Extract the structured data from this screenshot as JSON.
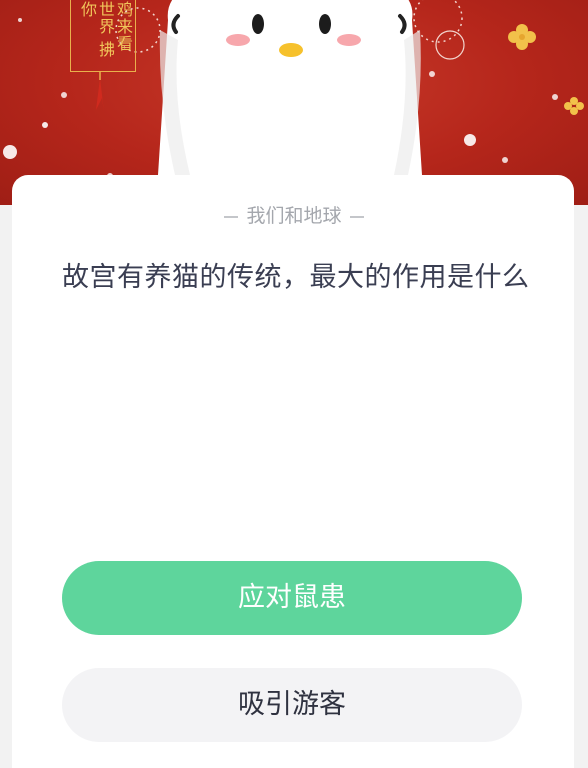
{
  "banner": {
    "calligraphy": "鸡来看世界 拂你",
    "colors": {
      "background": "#b5261b",
      "mascot": "#ffffff",
      "gold": "#f0c45a"
    }
  },
  "quiz": {
    "category": "我们和地球",
    "question": "故宫有养猫的传统，最大的作用是什么",
    "options": [
      {
        "label": "应对鼠患",
        "color": "#5ed59c"
      },
      {
        "label": "吸引游客",
        "color": "#f3f3f5"
      }
    ]
  }
}
